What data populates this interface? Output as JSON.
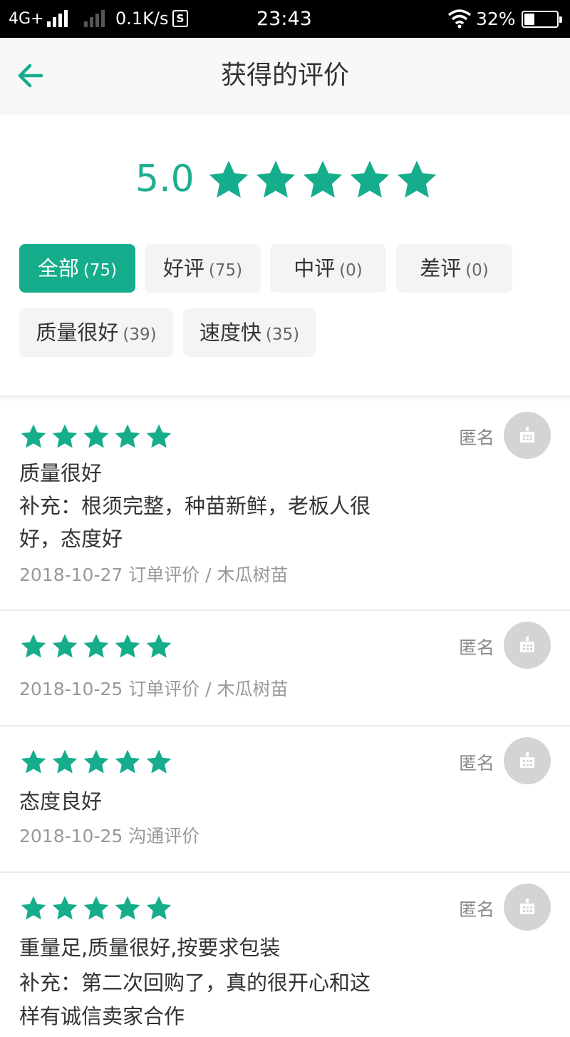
{
  "status_bar": {
    "network": "4G+",
    "speed": "0.1K/s",
    "sim_icon": "S",
    "time": "23:43",
    "battery_text": "32%",
    "battery_level": 0.32
  },
  "nav": {
    "title": "获得的评价",
    "back_icon": "arrow-left-icon"
  },
  "summary": {
    "score": "5.0",
    "stars": 5
  },
  "filters": [
    {
      "label": "全部",
      "count": "(75)",
      "active": true
    },
    {
      "label": "好评",
      "count": "(75)",
      "active": false
    },
    {
      "label": "中评",
      "count": "(0)",
      "active": false
    },
    {
      "label": "差评",
      "count": "(0)",
      "active": false
    },
    {
      "label": "质量很好",
      "count": "(39)",
      "active": false
    },
    {
      "label": "速度快",
      "count": "(35)",
      "active": false
    }
  ],
  "reviews": [
    {
      "stars": 5,
      "author": "匿名",
      "lines": [
        "质量很好",
        "补充：根须完整，种苗新鲜，老板人很",
        "好，态度好"
      ],
      "meta": "2018-10-27 订单评价 / 木瓜树苗"
    },
    {
      "stars": 5,
      "author": "匿名",
      "lines": [],
      "meta": "2018-10-25 订单评价 / 木瓜树苗"
    },
    {
      "stars": 5,
      "author": "匿名",
      "lines": [
        "态度良好"
      ],
      "meta": "2018-10-25 沟通评价"
    },
    {
      "stars": 5,
      "author": "匿名",
      "lines": [
        "重量足,质量很好,按要求包装",
        "补充：第二次回购了，真的很开心和这",
        "样有诚信卖家合作"
      ],
      "meta": ""
    }
  ],
  "colors": {
    "accent": "#16ad8c",
    "star": "#16ad8c",
    "score": "#1fae8f"
  }
}
